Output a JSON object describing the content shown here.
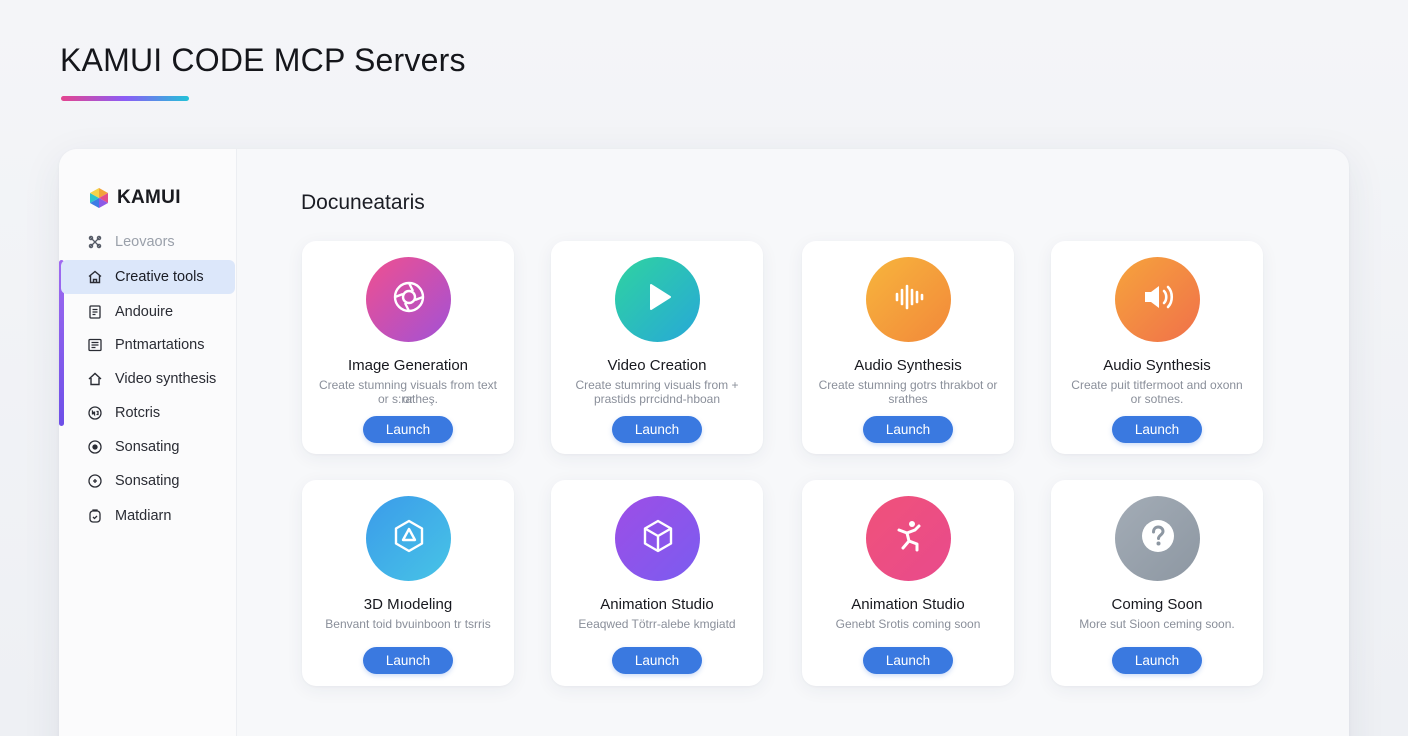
{
  "page": {
    "title": "KAMUI CODE MCP Servers"
  },
  "sidebar": {
    "brand": "KAMUI",
    "items": [
      {
        "label": "Leovaors",
        "icon": "tools-icon",
        "state": "muted"
      },
      {
        "label": "Creative tools",
        "icon": "home-icon",
        "state": "active"
      },
      {
        "label": "Andouire",
        "icon": "document-icon",
        "state": "normal"
      },
      {
        "label": "Pntmartations",
        "icon": "list-icon",
        "state": "normal"
      },
      {
        "label": "Video synthesis",
        "icon": "house-icon",
        "state": "normal"
      },
      {
        "label": "Rotcris",
        "icon": "badge-icon",
        "state": "normal"
      },
      {
        "label": "Sonsating",
        "icon": "record-icon",
        "state": "normal"
      },
      {
        "label": "Sonsating",
        "icon": "target-icon",
        "state": "normal"
      },
      {
        "label": "Matdiarn",
        "icon": "clipboard-icon",
        "state": "normal"
      }
    ]
  },
  "main": {
    "section_title": "Docuneataris",
    "cards": [
      {
        "title": "Image Generation",
        "desc_line1": "Create stumning visuals from text or",
        "desc_line2": "or s:ratheş.",
        "button": "Launch",
        "icon": "aperture-icon",
        "gradient": [
          "#f0508f",
          "#a251d6"
        ]
      },
      {
        "title": "Video Creation",
        "desc_line1": "Create stumring visuals from +",
        "desc_line2": "prastids prrcidnd-hboan",
        "button": "Launch",
        "icon": "play-icon",
        "gradient": [
          "#2fd3a0",
          "#27a8d8"
        ]
      },
      {
        "title": "Audio Synthesis",
        "desc_line1": "Create stumning gotrs thrakbot or",
        "desc_line2": "srathes",
        "button": "Launch",
        "icon": "waveform-icon",
        "gradient": [
          "#f7b53d",
          "#f2883a"
        ]
      },
      {
        "title": "Audio Synthesis",
        "desc_line1": "Create puit titfermoot and oxonn",
        "desc_line2": "or sotnes.",
        "button": "Launch",
        "icon": "speaker-icon",
        "gradient": [
          "#f6a43c",
          "#f0704a"
        ]
      },
      {
        "title": "3D Mıodeling",
        "desc_line1": "Benvant toid bvuinboon tr tsrris",
        "desc_line2": "",
        "button": "Launch",
        "icon": "cube-outline-icon",
        "gradient": [
          "#3b9bea",
          "#47c4e6"
        ]
      },
      {
        "title": "Animation Studio",
        "desc_line1": "Eeaqwed Tötrr-alebe kmgiatd",
        "desc_line2": "",
        "button": "Launch",
        "icon": "cube-icon",
        "gradient": [
          "#9d4ee6",
          "#7b5cf0"
        ]
      },
      {
        "title": "Animation Studio",
        "desc_line1": "Genebt Srotis coming soon",
        "desc_line2": "",
        "button": "Launch",
        "icon": "figure-icon",
        "gradient": [
          "#f0527a",
          "#e84a8c"
        ]
      },
      {
        "title": "Coming Soon",
        "desc_line1": "More sut Sioon ceming soon.",
        "desc_line2": "",
        "button": "Launch",
        "icon": "question-icon",
        "gradient": [
          "#a3acb6",
          "#8d97a2"
        ]
      }
    ]
  }
}
